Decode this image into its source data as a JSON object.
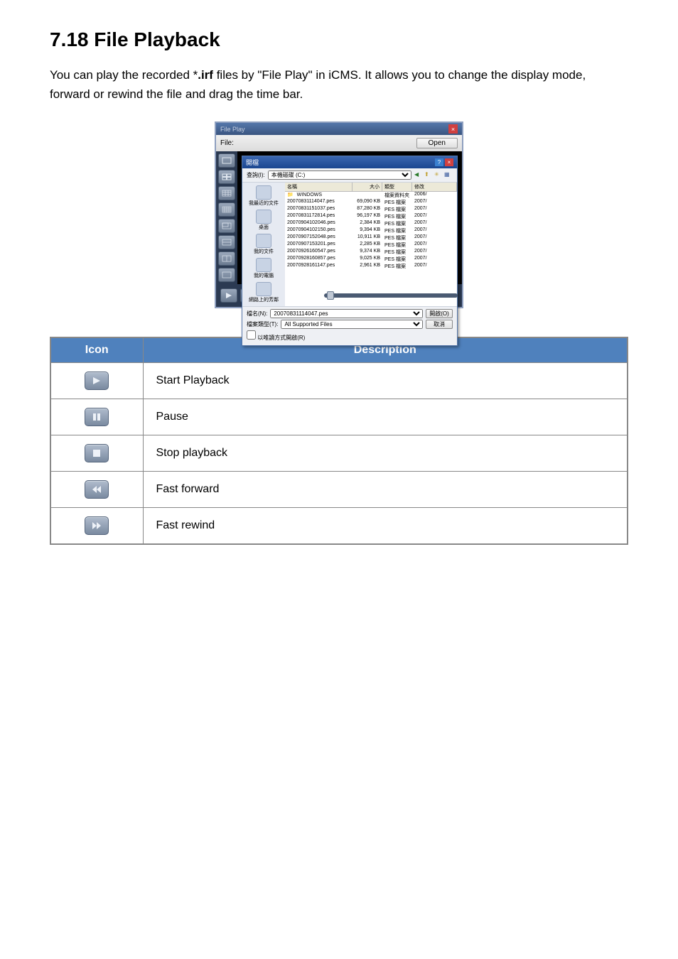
{
  "heading": "7.18 File Playback",
  "intro_pre": "You can play the recorded *",
  "intro_bold": ".irf",
  "intro_post": " files by \"File Play\" in iCMS. It allows you to change the display mode, forward or rewind the file and drag the time bar.",
  "fileplay": {
    "title": "File Play",
    "file_label": "File:",
    "open_btn": "Open"
  },
  "dialog": {
    "title": "開檔",
    "lookin_label": "查詢(I):",
    "drive": "本機磁碟 (C:)",
    "side": [
      "我最近的文件",
      "桌面",
      "我的文件",
      "我的電腦",
      "網路上的芳鄰"
    ],
    "cols": {
      "name": "名稱",
      "size": "大小",
      "type": "類型",
      "mod": "修改"
    },
    "folder": "WINDOWS",
    "folder_type": "檔案資料夾",
    "folder_date": "2006/",
    "files": [
      {
        "n": "20070831114047.pes",
        "s": "69,090 KB",
        "t": "PES 檔案",
        "d": "2007/"
      },
      {
        "n": "20070831151037.pes",
        "s": "87,280 KB",
        "t": "PES 檔案",
        "d": "2007/"
      },
      {
        "n": "20070831172814.pes",
        "s": "96,197 KB",
        "t": "PES 檔案",
        "d": "2007/"
      },
      {
        "n": "20070904102046.pes",
        "s": "2,384 KB",
        "t": "PES 檔案",
        "d": "2007/"
      },
      {
        "n": "20070904102150.pes",
        "s": "9,394 KB",
        "t": "PES 檔案",
        "d": "2007/"
      },
      {
        "n": "20070907152048.pes",
        "s": "10,911 KB",
        "t": "PES 檔案",
        "d": "2007/"
      },
      {
        "n": "20070907153201.pes",
        "s": "2,285 KB",
        "t": "PES 檔案",
        "d": "2007/"
      },
      {
        "n": "20070926160547.pes",
        "s": "9,374 KB",
        "t": "PES 檔案",
        "d": "2007/"
      },
      {
        "n": "20070928160857.pes",
        "s": "9,025 KB",
        "t": "PES 檔案",
        "d": "2007/"
      },
      {
        "n": "20070928161147.pes",
        "s": "2,961 KB",
        "t": "PES 檔案",
        "d": "2007/"
      }
    ],
    "filename_label": "檔名(N):",
    "filename_value": "20070831114047.pes",
    "filetype_label": "檔案類型(T):",
    "filetype_value": "All Supported Files",
    "readonly": "以唯讀方式開啟(R)",
    "open_btn": "開啟(O)",
    "cancel_btn": "取消"
  },
  "table": {
    "header_icon": "Icon",
    "header_desc": "Description",
    "rows": {
      "play": "Start Playback",
      "pause": "Pause",
      "stop": "Stop playback",
      "fast_forward": "Fast forward",
      "fast_rewind": "Fast rewind"
    }
  }
}
